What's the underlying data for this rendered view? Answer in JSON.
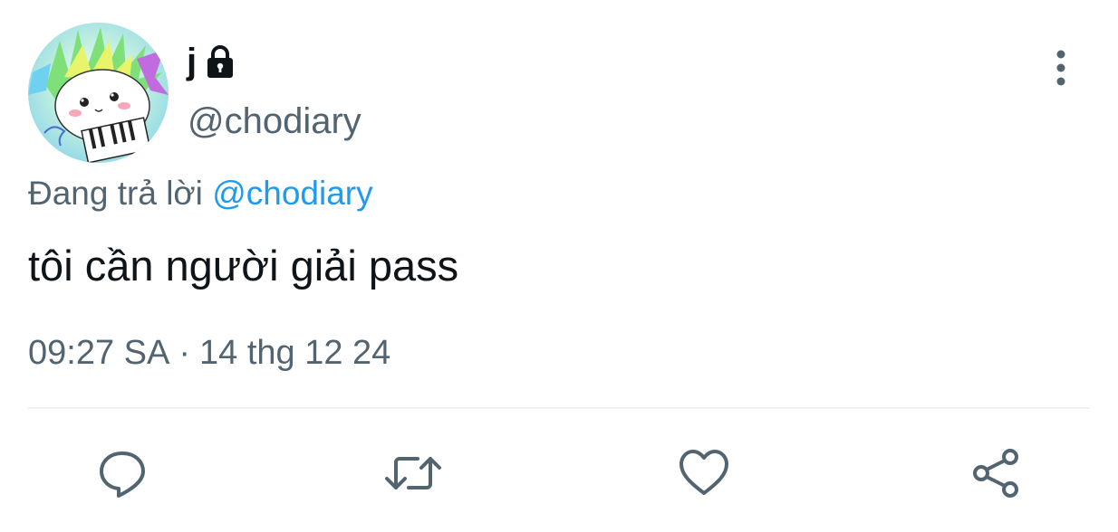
{
  "author": {
    "display_name": "j",
    "handle": "@chodiary",
    "protected_icon": "lock-icon",
    "avatar_icon": "hamster-avatar"
  },
  "reply_context": {
    "prefix": "Đang trả lời ",
    "mention": "@chodiary"
  },
  "tweet": {
    "text": "tôi cần người giải pass"
  },
  "meta": {
    "time": "09:27 SA",
    "separator": "·",
    "date": "14 thg 12 24"
  },
  "actions": [
    {
      "name": "reply",
      "icon": "speech-bubble-icon"
    },
    {
      "name": "retweet",
      "icon": "retweet-icon"
    },
    {
      "name": "like",
      "icon": "heart-icon"
    },
    {
      "name": "share",
      "icon": "share-icon"
    }
  ],
  "more_menu": {
    "icon": "vertical-dots-icon"
  },
  "colors": {
    "text_primary": "#0f1419",
    "text_secondary": "#536471",
    "link": "#1d9bf0",
    "divider": "#eff3f4"
  }
}
